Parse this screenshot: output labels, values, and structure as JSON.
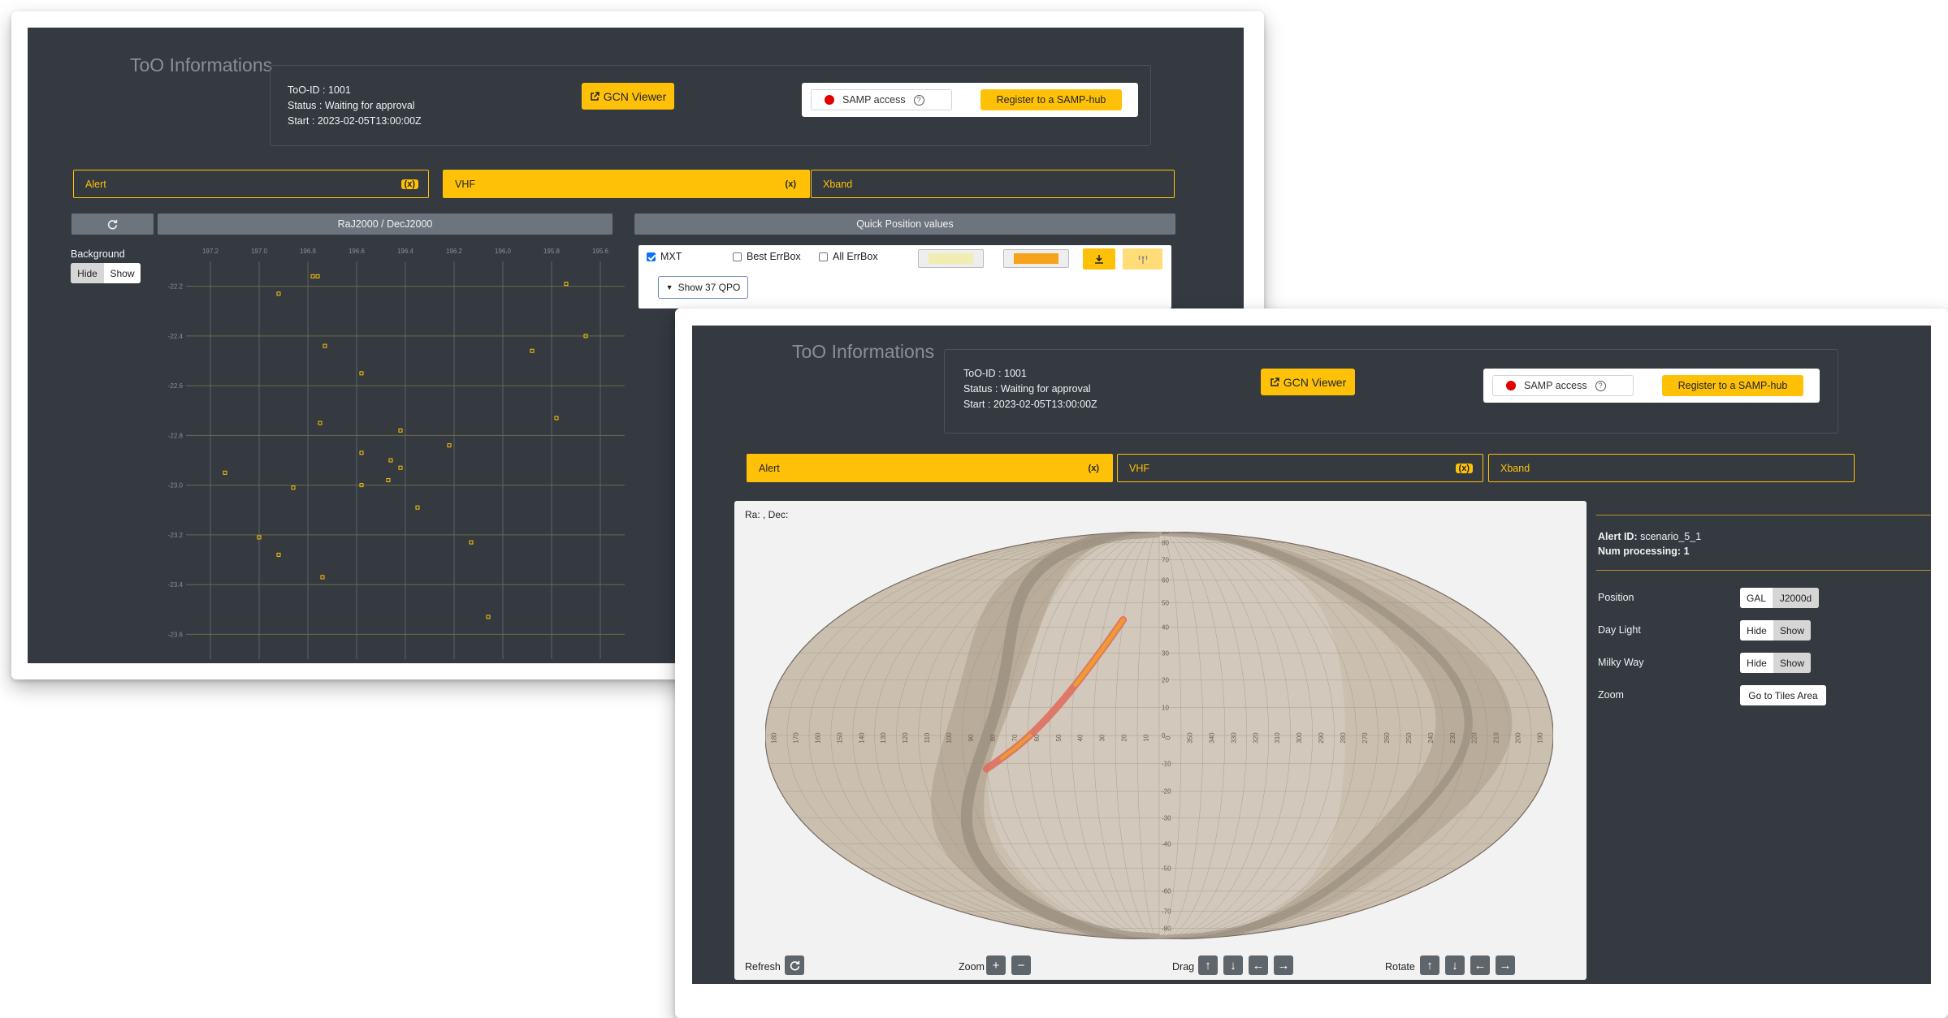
{
  "shared": {
    "too_title": "ToO Informations",
    "too_id": "ToO-ID : 1001",
    "status": "Status : Waiting for approval",
    "start": "Start : 2023-02-05T13:00:00Z",
    "gcn_viewer": "GCN Viewer",
    "samp_access": "SAMP access",
    "samp_help": "?",
    "register": "Register to a SAMP-hub",
    "tabs": {
      "alert": "Alert",
      "vhf": "VHF",
      "xband": "Xband",
      "close_badge": "(x)"
    }
  },
  "back": {
    "refresh_icon": "refresh-icon",
    "coord_bar": "RaJ2000 / DecJ2000",
    "quick_bar": "Quick Position values",
    "background_label": "Background",
    "hide": "Hide",
    "show": "Show",
    "qpv": {
      "mxt": "MXT",
      "best_errbox": "Best ErrBox",
      "all_errbox": "All ErrBox",
      "show_qpo": "Show 37 QPO",
      "swatch1_color": "#f1edb0",
      "swatch2_color": "#f7a21b"
    },
    "chart_data": {
      "type": "scatter",
      "x_ticks": [
        "197.2",
        "197.0",
        "196.8",
        "196.6",
        "196.4",
        "196.2",
        "196.0",
        "195.8",
        "195.6"
      ],
      "y_ticks": [
        "-22.2",
        "-22.4",
        "-22.6",
        "-22.8",
        "-23.0",
        "-23.2",
        "-23.4",
        "-23.6"
      ],
      "xlim": [
        197.3,
        195.5
      ],
      "ylim": [
        -23.7,
        -22.1
      ],
      "grid": true,
      "marker_color": "#ffc107",
      "points": [
        [
          196.92,
          -22.23
        ],
        [
          196.78,
          -22.16
        ],
        [
          196.76,
          -22.16
        ],
        [
          196.73,
          -22.44
        ],
        [
          196.58,
          -22.55
        ],
        [
          196.75,
          -22.75
        ],
        [
          196.42,
          -22.78
        ],
        [
          196.22,
          -22.84
        ],
        [
          196.58,
          -22.87
        ],
        [
          196.46,
          -22.9
        ],
        [
          196.42,
          -22.93
        ],
        [
          196.47,
          -22.98
        ],
        [
          197.14,
          -22.95
        ],
        [
          196.86,
          -23.01
        ],
        [
          196.58,
          -23.0
        ],
        [
          196.35,
          -23.09
        ],
        [
          196.13,
          -23.23
        ],
        [
          197.0,
          -23.21
        ],
        [
          196.92,
          -23.28
        ],
        [
          196.74,
          -23.37
        ],
        [
          196.06,
          -23.53
        ],
        [
          195.74,
          -22.19
        ],
        [
          195.78,
          -22.73
        ],
        [
          195.66,
          -22.4
        ],
        [
          195.88,
          -22.46
        ]
      ]
    }
  },
  "front": {
    "radec": "Ra: , Dec:",
    "refresh": "Refresh",
    "zoom": "Zoom",
    "drag": "Drag",
    "rotate": "Rotate",
    "alert_id_label": "Alert ID:",
    "alert_id_value": "scenario_5_1",
    "num_processing_label": "Num processing:",
    "num_processing_value": "1",
    "position": "Position",
    "gal": "GAL",
    "j2000d": "J2000d",
    "day_light": "Day Light",
    "milky_way": "Milky Way",
    "zoom_label": "Zoom",
    "go_tiles": "Go to Tiles Area",
    "hide": "Hide",
    "show": "Show",
    "map": {
      "lat_labels": [
        "90",
        "80",
        "70",
        "60",
        "50",
        "40",
        "30",
        "20",
        "10",
        "0",
        "-10",
        "-20",
        "-30",
        "-40",
        "-50",
        "-60",
        "-70",
        "-80"
      ],
      "lon_labels": [
        "180",
        "170",
        "160",
        "150",
        "140",
        "130",
        "120",
        "110",
        "100",
        "90",
        "80",
        "70",
        "60",
        "50",
        "40",
        "30",
        "20",
        "10",
        "0",
        "350",
        "340",
        "330",
        "320",
        "310",
        "300",
        "290",
        "280",
        "270",
        "260",
        "250",
        "240",
        "230",
        "220",
        "210",
        "200",
        "190"
      ],
      "ocean_color": "#cbbfb0",
      "band_color": "#b3a593"
    }
  }
}
